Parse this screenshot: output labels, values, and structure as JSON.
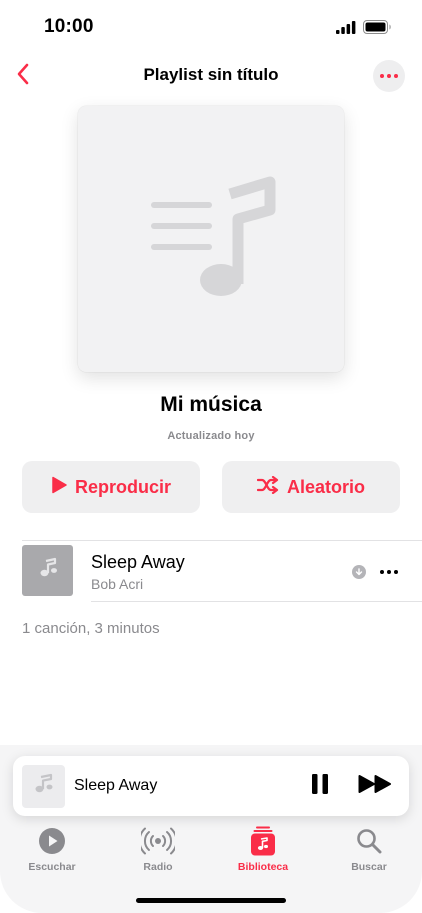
{
  "status_bar": {
    "time": "10:00",
    "icons": [
      "cellular-signal-icon",
      "battery-icon"
    ]
  },
  "nav": {
    "back_icon": "chevron-left-icon",
    "title": "Playlist sin título",
    "more_icon": "ellipsis-icon"
  },
  "playlist": {
    "artwork_icon": "music-note-list-icon",
    "name": "Mi música",
    "updated": "Actualizado hoy"
  },
  "actions": {
    "play_label": "Reproducir",
    "play_icon": "play-icon",
    "shuffle_label": "Aleatorio",
    "shuffle_icon": "shuffle-icon"
  },
  "tracks": [
    {
      "title": "Sleep Away",
      "artist": "Bob Acri",
      "downloaded_icon": "download-arrow-icon",
      "more_icon": "ellipsis-icon"
    }
  ],
  "summary": "1 canción, 3 minutos",
  "mini_player": {
    "title": "Sleep Away",
    "pause_icon": "pause-icon",
    "forward_icon": "forward-icon"
  },
  "tabs": [
    {
      "label": "Escuchar",
      "icon": "play-circle-icon",
      "active": false
    },
    {
      "label": "Radio",
      "icon": "radio-waves-icon",
      "active": false
    },
    {
      "label": "Biblioteca",
      "icon": "library-icon",
      "active": true
    },
    {
      "label": "Buscar",
      "icon": "search-icon",
      "active": false
    }
  ],
  "colors": {
    "accent": "#fa2d48",
    "secondary_text": "#8a8a8e",
    "button_background": "#efeff0"
  }
}
